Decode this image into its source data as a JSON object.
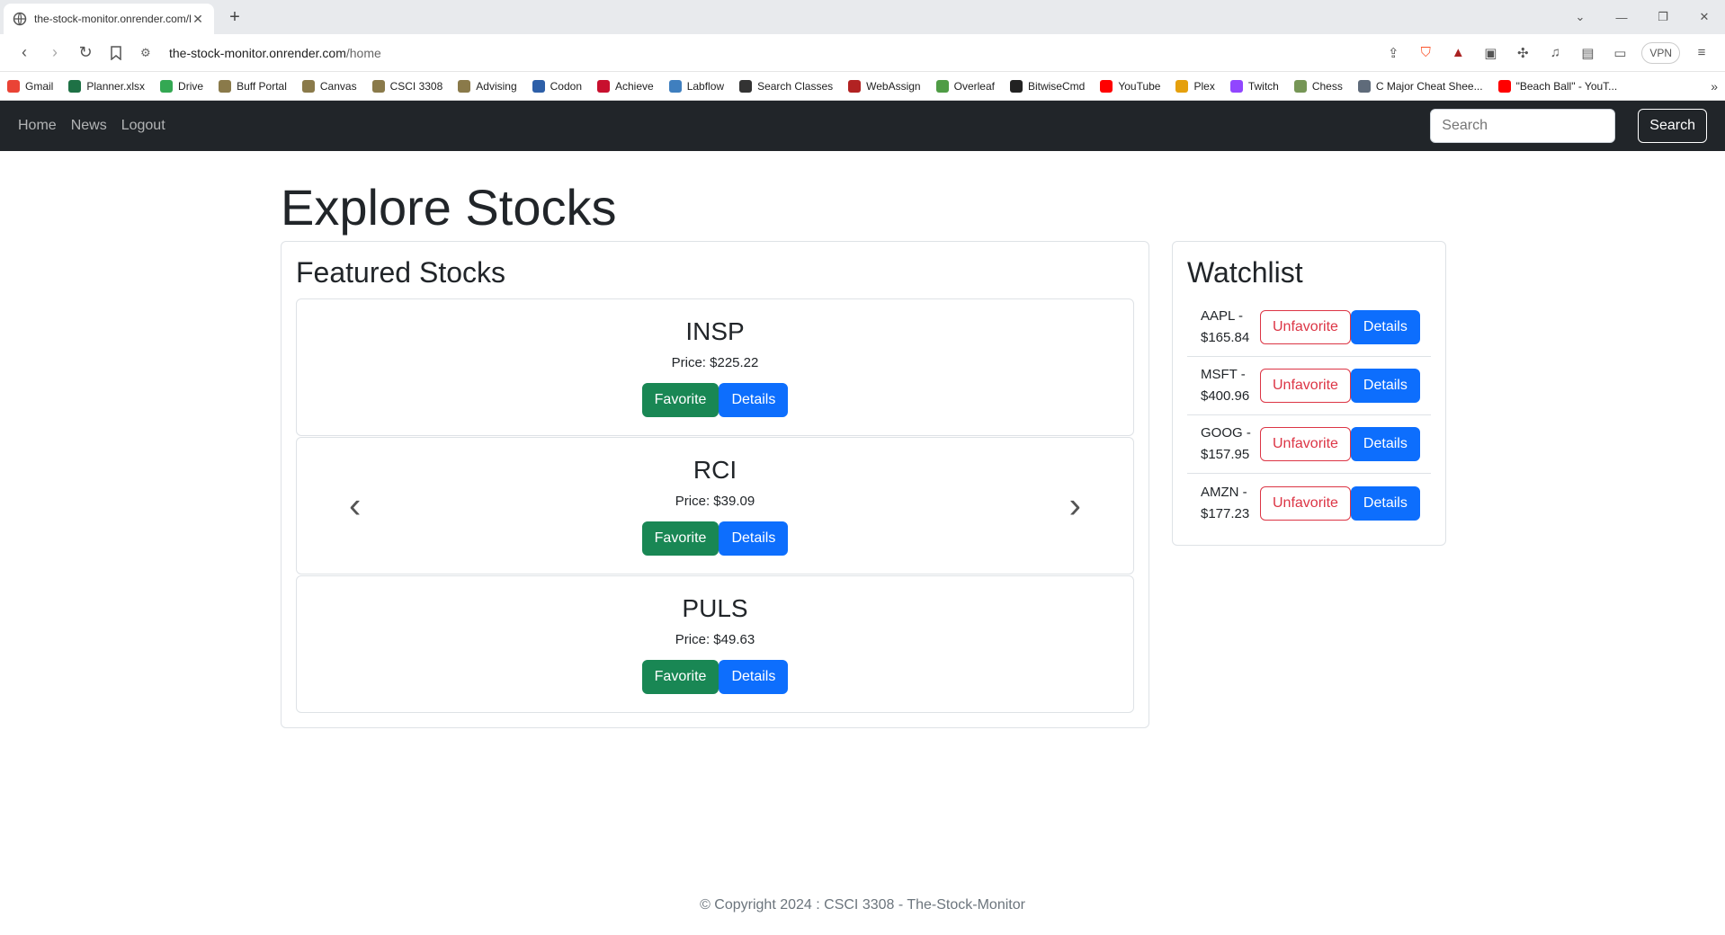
{
  "browser": {
    "tab_title": "the-stock-monitor.onrender.com/home",
    "url_host": "the-stock-monitor.onrender.com",
    "url_path": "/home",
    "vpn_label": "VPN",
    "bookmarks": [
      {
        "label": "Gmail",
        "color": "#ea4335"
      },
      {
        "label": "Planner.xlsx",
        "color": "#1e7145"
      },
      {
        "label": "Drive",
        "color": "#34a853"
      },
      {
        "label": "Buff Portal",
        "color": "#8a7a4a"
      },
      {
        "label": "Canvas",
        "color": "#8a7a4a"
      },
      {
        "label": "CSCI 3308",
        "color": "#8a7a4a"
      },
      {
        "label": "Advising",
        "color": "#8a7a4a"
      },
      {
        "label": "Codon",
        "color": "#2d5fa8"
      },
      {
        "label": "Achieve",
        "color": "#c8102e"
      },
      {
        "label": "Labflow",
        "color": "#3f7fbf"
      },
      {
        "label": "Search Classes",
        "color": "#333333"
      },
      {
        "label": "WebAssign",
        "color": "#b22222"
      },
      {
        "label": "Overleaf",
        "color": "#4f9c45"
      },
      {
        "label": "BitwiseCmd",
        "color": "#222222"
      },
      {
        "label": "YouTube",
        "color": "#ff0000"
      },
      {
        "label": "Plex",
        "color": "#e5a00d"
      },
      {
        "label": "Twitch",
        "color": "#9146ff"
      },
      {
        "label": "Chess",
        "color": "#769656"
      },
      {
        "label": "C Major Cheat Shee...",
        "color": "#5f6b7a"
      },
      {
        "label": "\"Beach Ball\" - YouT...",
        "color": "#ff0000"
      }
    ]
  },
  "nav": {
    "links": [
      "Home",
      "News",
      "Logout"
    ],
    "search_placeholder": "Search",
    "search_button": "Search"
  },
  "page": {
    "title": "Explore Stocks"
  },
  "featured": {
    "heading": "Featured Stocks",
    "favorite_label": "Favorite",
    "details_label": "Details",
    "stocks": [
      {
        "symbol": "INSP",
        "price": "Price: $225.22"
      },
      {
        "symbol": "RCI",
        "price": "Price: $39.09"
      },
      {
        "symbol": "PULS",
        "price": "Price: $49.63"
      }
    ]
  },
  "watchlist": {
    "heading": "Watchlist",
    "unfavorite_label": "Unfavorite",
    "details_label": "Details",
    "items": [
      {
        "symbol": "AAPL -",
        "price": "$165.84"
      },
      {
        "symbol": "MSFT -",
        "price": "$400.96"
      },
      {
        "symbol": "GOOG -",
        "price": "$157.95"
      },
      {
        "symbol": "AMZN -",
        "price": "$177.23"
      }
    ]
  },
  "footer": {
    "text": "© Copyright 2024 : CSCI 3308 - The-Stock-Monitor"
  }
}
